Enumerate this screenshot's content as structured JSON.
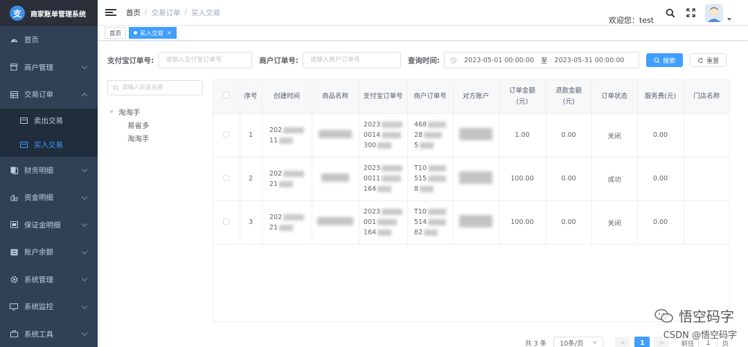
{
  "app": {
    "logo_char": "支",
    "title": "商家账单管理系统"
  },
  "sidebar": {
    "items": [
      {
        "label": "首页",
        "icon": "dashboard-icon"
      },
      {
        "label": "商户管理",
        "icon": "shop-icon"
      },
      {
        "label": "交易订单",
        "icon": "table-icon",
        "expanded": true,
        "children": [
          {
            "label": "卖出交易",
            "active": false
          },
          {
            "label": "买入交易",
            "active": true
          }
        ]
      },
      {
        "label": "财务明细",
        "icon": "finance-icon"
      },
      {
        "label": "资金明细",
        "icon": "fund-icon"
      },
      {
        "label": "保证金明细",
        "icon": "deposit-icon"
      },
      {
        "label": "账户余额",
        "icon": "balance-icon"
      },
      {
        "label": "系统管理",
        "icon": "gear-icon"
      },
      {
        "label": "系统监控",
        "icon": "monitor-icon"
      },
      {
        "label": "系统工具",
        "icon": "tool-icon"
      }
    ]
  },
  "header": {
    "breadcrumb": [
      "首页",
      "交易订单",
      "买入交易"
    ],
    "breadcrumb_sep": "/",
    "welcome": "欢迎您：test"
  },
  "tags": [
    {
      "label": "首页",
      "active": false
    },
    {
      "label": "买入交易",
      "active": true,
      "close": "×"
    }
  ],
  "search": {
    "alipay_label": "支付宝订单号:",
    "alipay_placeholder": "请输入支付宝订单号",
    "merchant_label": "商户订单号:",
    "merchant_placeholder": "请输入商户订单号",
    "time_label": "查询时间:",
    "start": "2023-05-01 00:00:00",
    "to": "至",
    "end": "2023-05-31 00:00:00",
    "search_btn": "搜索",
    "reset_btn": "重置"
  },
  "tree": {
    "placeholder": "请输入商家名称",
    "root": "淘淘手",
    "children": [
      "易省多",
      "淘淘手"
    ]
  },
  "table": {
    "headers": [
      "",
      "序号",
      "创建时间",
      "商品名称",
      "支付宝订单号",
      "商户订单号",
      "对方账户",
      "订单金额\n(元)",
      "退款金额\n(元)",
      "订单状态",
      "服务费(元)",
      "门店名称"
    ],
    "rows": [
      {
        "index": "1",
        "created": [
          "202",
          "11"
        ],
        "alipay": [
          "2023",
          "0014",
          "300"
        ],
        "merchant": [
          "468",
          "28",
          "5"
        ],
        "amount": "1.00",
        "refund": "0.00",
        "status": "关闭",
        "fee": "0.00"
      },
      {
        "index": "2",
        "created": [
          "202",
          "21"
        ],
        "alipay": [
          "2023",
          "0011",
          "164"
        ],
        "merchant": [
          "T10",
          "515",
          "8"
        ],
        "amount": "100.00",
        "refund": "0.00",
        "status": "成功",
        "fee": "0.00"
      },
      {
        "index": "3",
        "created": [
          "202",
          "21"
        ],
        "alipay": [
          "2023",
          "001",
          "164"
        ],
        "merchant": [
          "T10",
          "514",
          "82"
        ],
        "amount": "100.00",
        "refund": "0.00",
        "status": "关闭",
        "fee": "0.00"
      }
    ]
  },
  "pagination": {
    "total": "共 3 条",
    "page_size": "10条/页",
    "prev": "<",
    "current": "1",
    "next": ">",
    "goto_prefix": "前往",
    "goto_value": "1",
    "goto_suffix": "页"
  },
  "watermark": {
    "text": "悟空码字",
    "csdn": "CSDN @悟空码字"
  },
  "colors": {
    "sidebar_bg": "#304156",
    "primary": "#409eff",
    "sub_bg": "#1f2d3d"
  }
}
